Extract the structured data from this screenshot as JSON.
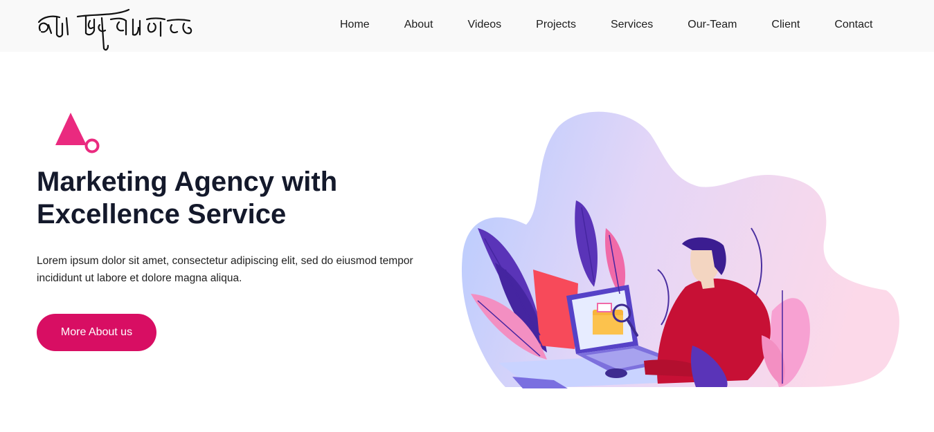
{
  "header": {
    "logo_text": "আমি কিন্তু মহা খাদক",
    "nav": [
      {
        "label": "Home"
      },
      {
        "label": "About"
      },
      {
        "label": "Videos"
      },
      {
        "label": "Projects"
      },
      {
        "label": "Services"
      },
      {
        "label": "Our-Team"
      },
      {
        "label": "Client"
      },
      {
        "label": "Contact"
      }
    ]
  },
  "hero": {
    "title": "Marketing Agency with Excellence Service",
    "description": "Lorem ipsum dolor sit amet, consectetur adipiscing elit, sed do eiusmod tempor incididunt ut labore et dolore magna aliqua.",
    "cta_label": "More About us"
  },
  "colors": {
    "accent": "#d80e63",
    "decor_pink": "#ea2a7f",
    "heading": "#14192b",
    "nav_bg": "#f9f9f9"
  }
}
